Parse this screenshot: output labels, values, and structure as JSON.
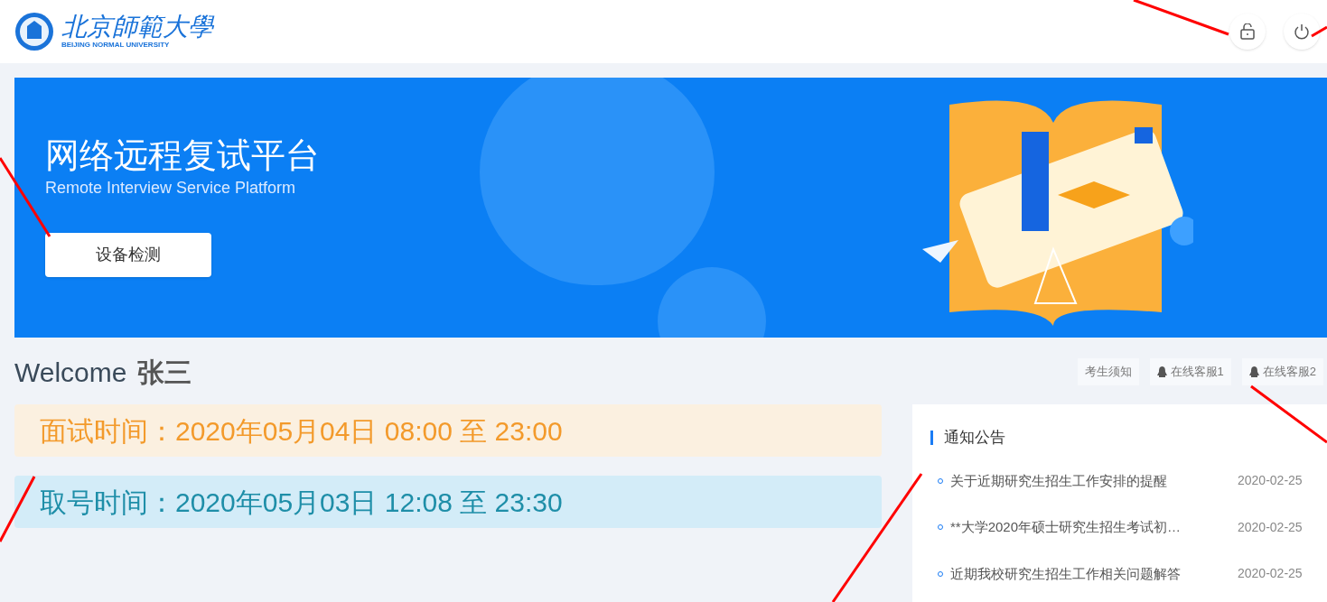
{
  "header": {
    "logo_name": "北京師範大學",
    "logo_subtitle": "BEIJING NORMAL UNIVERSITY"
  },
  "banner": {
    "title": "网络远程复试平台",
    "subtitle": "Remote Interview Service Platform",
    "button": "设备检测"
  },
  "welcome": {
    "greeting": "Welcome",
    "name": "张三"
  },
  "quick_links": [
    {
      "kind": "plain",
      "label": "考生须知"
    },
    {
      "kind": "support",
      "label": "在线客服1"
    },
    {
      "kind": "support",
      "label": "在线客服2"
    }
  ],
  "time_bars": [
    {
      "kind": "interview",
      "text": "面试时间：2020年05月04日 08:00 至 23:00"
    },
    {
      "kind": "ticket",
      "text": "取号时间：2020年05月03日 12:08 至 23:30"
    }
  ],
  "notices": {
    "title": "通知公告",
    "items": [
      {
        "title": "关于近期研究生招生工作安排的提醒",
        "date": "2020-02-25"
      },
      {
        "title": "**大学2020年硕士研究生招生考试初…",
        "date": "2020-02-25"
      },
      {
        "title": "近期我校研究生招生工作相关问题解答",
        "date": "2020-02-25"
      }
    ]
  }
}
